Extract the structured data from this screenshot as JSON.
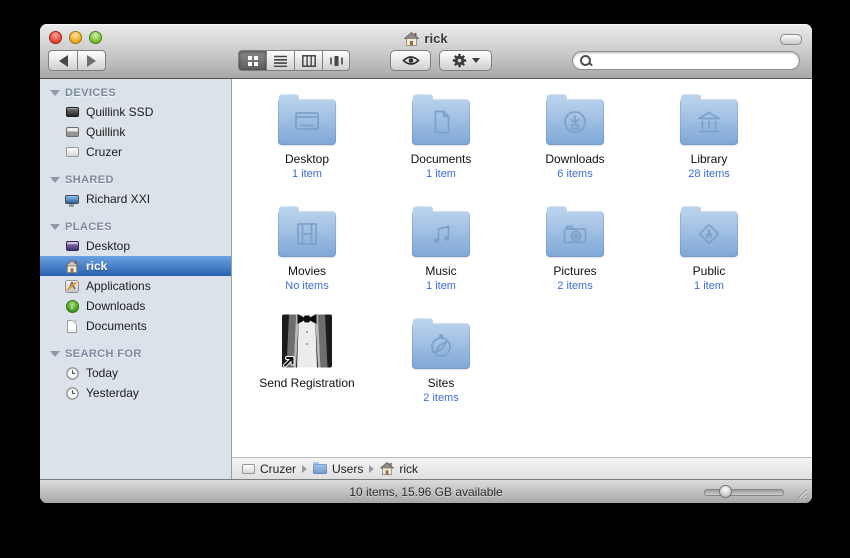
{
  "window": {
    "title": "rick"
  },
  "toolbar": {
    "icons": [
      "back-icon",
      "forward-icon",
      "icon-view-icon",
      "list-view-icon",
      "column-view-icon",
      "coverflow-view-icon",
      "eye-icon",
      "gear-icon",
      "search-icon"
    ],
    "search_value": ""
  },
  "sidebar": {
    "sections": [
      {
        "label": "DEVICES",
        "items": [
          {
            "label": "Quillink SSD",
            "icon": "ssd-drive-icon",
            "selected": false
          },
          {
            "label": "Quillink",
            "icon": "hard-drive-icon",
            "selected": false
          },
          {
            "label": "Cruzer",
            "icon": "removable-drive-icon",
            "selected": false
          }
        ]
      },
      {
        "label": "SHARED",
        "items": [
          {
            "label": "Richard XXI",
            "icon": "shared-computer-icon",
            "selected": false
          }
        ]
      },
      {
        "label": "PLACES",
        "items": [
          {
            "label": "Desktop",
            "icon": "desktop-icon",
            "selected": false
          },
          {
            "label": "rick",
            "icon": "home-icon",
            "selected": true
          },
          {
            "label": "Applications",
            "icon": "applications-icon",
            "selected": false
          },
          {
            "label": "Downloads",
            "icon": "downloads-icon",
            "selected": false
          },
          {
            "label": "Documents",
            "icon": "document-icon",
            "selected": false
          }
        ]
      },
      {
        "label": "SEARCH FOR",
        "items": [
          {
            "label": "Today",
            "icon": "clock-icon",
            "selected": false
          },
          {
            "label": "Yesterday",
            "icon": "clock-icon",
            "selected": false
          }
        ]
      }
    ]
  },
  "main": {
    "items": [
      {
        "name": "Desktop",
        "count": "1 item",
        "icon": "desktop-folder-icon"
      },
      {
        "name": "Documents",
        "count": "1 item",
        "icon": "documents-folder-icon"
      },
      {
        "name": "Downloads",
        "count": "6 items",
        "icon": "downloads-folder-icon"
      },
      {
        "name": "Library",
        "count": "28 items",
        "icon": "library-folder-icon"
      },
      {
        "name": "Movies",
        "count": "No items",
        "icon": "movies-folder-icon"
      },
      {
        "name": "Music",
        "count": "1 item",
        "icon": "music-folder-icon"
      },
      {
        "name": "Pictures",
        "count": "2 items",
        "icon": "pictures-folder-icon"
      },
      {
        "name": "Public",
        "count": "1 item",
        "icon": "public-folder-icon"
      },
      {
        "name": "Send Registration",
        "count": "",
        "icon": "tuxedo-alias-icon"
      },
      {
        "name": "Sites",
        "count": "2 items",
        "icon": "sites-folder-icon"
      }
    ]
  },
  "pathbar": {
    "items": [
      {
        "label": "Cruzer",
        "icon": "drive-icon"
      },
      {
        "label": "Users",
        "icon": "folder-icon"
      },
      {
        "label": "rick",
        "icon": "home-icon"
      }
    ]
  },
  "statusbar": {
    "text": "10 items, 15.96 GB available"
  },
  "colors": {
    "selection_blue": "#2a61ae",
    "folder_blue": "#8fb4dc",
    "count_text": "#3d6bd0",
    "sidebar_bg": "#dbe2ea"
  }
}
